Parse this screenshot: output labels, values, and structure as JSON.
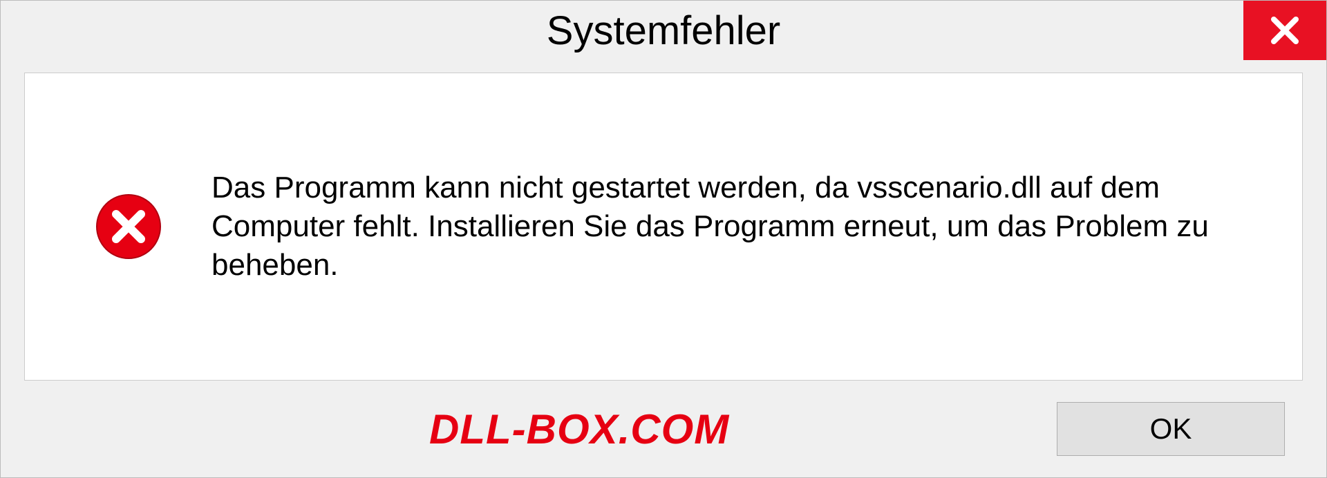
{
  "dialog": {
    "title": "Systemfehler",
    "message": "Das Programm kann nicht gestartet werden, da vsscenario.dll auf dem Computer fehlt. Installieren Sie das Programm erneut, um das Problem zu beheben.",
    "ok_label": "OK"
  },
  "watermark": "DLL-BOX.COM"
}
